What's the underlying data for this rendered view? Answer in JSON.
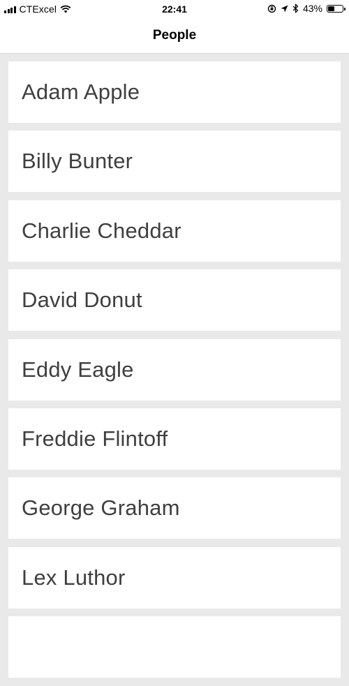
{
  "status_bar": {
    "carrier": "CTExcel",
    "time": "22:41",
    "battery_percent": "43%",
    "battery_level": 0.43,
    "icons": [
      "signal-bars-icon",
      "wifi-icon",
      "orientation-lock-icon",
      "location-icon",
      "bluetooth-icon",
      "battery-icon"
    ]
  },
  "nav": {
    "title": "People"
  },
  "people": [
    {
      "name": "Adam Apple"
    },
    {
      "name": "Billy Bunter"
    },
    {
      "name": "Charlie Cheddar"
    },
    {
      "name": "David Donut"
    },
    {
      "name": "Eddy Eagle"
    },
    {
      "name": "Freddie Flintoff"
    },
    {
      "name": "George Graham"
    },
    {
      "name": "Lex Luthor"
    }
  ],
  "colors": {
    "background": "#e9e9e9",
    "row_background": "#ffffff",
    "row_text": "#3f3f3f"
  }
}
